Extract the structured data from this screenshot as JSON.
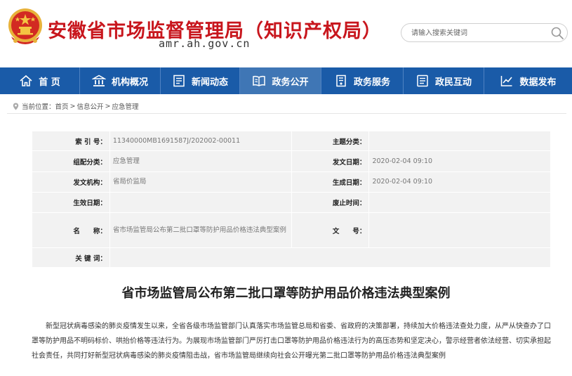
{
  "header": {
    "title": "安徽省市场监督管理局（知识产权局）",
    "domain": "amr.ah.gov.cn",
    "search_placeholder": "请输入搜索关键词"
  },
  "nav": {
    "items": [
      {
        "label": "首 页",
        "icon": "home-icon"
      },
      {
        "label": "机构概况",
        "icon": "building-icon"
      },
      {
        "label": "新闻动态",
        "icon": "news-icon"
      },
      {
        "label": "政务公开",
        "icon": "book-icon",
        "active": true
      },
      {
        "label": "政务服务",
        "icon": "service-icon"
      },
      {
        "label": "政民互动",
        "icon": "interaction-icon"
      },
      {
        "label": "数据发布",
        "icon": "chart-icon"
      }
    ]
  },
  "breadcrumb": {
    "prefix": "当前位置：",
    "items": [
      "首页",
      "信息公开",
      "应急管理"
    ],
    "separator": ">"
  },
  "info": {
    "index_label": "索 引 号：",
    "index_value": "11340000MB1691587J/202002-00011",
    "topic_label": "主题分类：",
    "topic_value": "",
    "category_label": "组配分类：",
    "category_value": "应急管理",
    "date_label": "发文日期：",
    "date_value": "2020-02-04 09:10",
    "org_label": "发文机构：",
    "org_value": "省局价监局",
    "created_label": "生成日期：",
    "created_value": "2020-02-04 09:10",
    "effective_label": "生效日期：",
    "effective_value": "",
    "expire_label": "废止时间：",
    "expire_value": "",
    "name_label": "名　　称：",
    "name_value": "省市场监管局公布第二批口罩等防护用品价格违法典型案例",
    "docno_label": "文　　号：",
    "docno_value": "",
    "keywords_label": "关 键 词：",
    "keywords_value": ""
  },
  "article": {
    "title": "省市场监管局公布第二批口罩等防护用品价格违法典型案例",
    "body": "新型冠状病毒感染的肺炎疫情发生以来，全省各级市场监管部门认真落实市场监管总局和省委、省政府的决策部署，持续加大价格违法查处力度，从严从快查办了口罩等防护用品不明码标价、哄抬价格等违法行为。为展现市场监管部门严厉打击口罩等防护用品价格违法行为的高压态势和坚定决心，警示经营者依法经营、切实承担起社会责任，共同打好新型冠状病毒感染的肺炎疫情阻击战，省市场监管局继续向社会公开曝光第二批口罩等防护用品价格违法典型案例"
  },
  "colors": {
    "brand_red": "#c8161d",
    "nav_blue": "#1a5ba8",
    "nav_active": "#3f76b5"
  }
}
